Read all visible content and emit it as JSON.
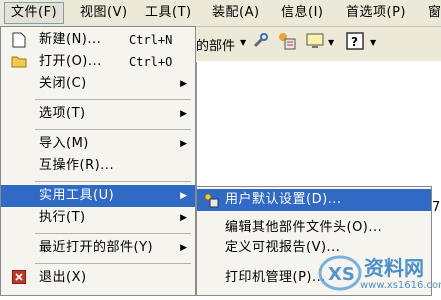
{
  "menubar": {
    "items": [
      {
        "label": "文件(F)",
        "active": true
      },
      {
        "label": "视图(V)"
      },
      {
        "label": "工具(T)"
      },
      {
        "label": "装配(A)"
      },
      {
        "label": "信息(I)"
      },
      {
        "label": "首选项(P)"
      },
      {
        "label": "窗"
      }
    ]
  },
  "toolbar": {
    "partial_text": "的部件",
    "icons": [
      "tool-icon",
      "part-navigator-icon",
      "monitor-icon",
      "help-icon"
    ]
  },
  "file_menu": {
    "items": [
      {
        "label": "新建(N)...",
        "shortcut": "Ctrl+N",
        "icon": "new-file-icon"
      },
      {
        "label": "打开(O)...",
        "shortcut": "Ctrl+O",
        "icon": "open-folder-icon"
      },
      {
        "label": "关闭(C)",
        "submenu": true
      },
      {
        "label": "选项(T)",
        "submenu": true
      },
      {
        "label": "导入(M)",
        "submenu": true
      },
      {
        "label": "互操作(R)..."
      },
      {
        "label": "实用工具(U)",
        "submenu": true,
        "highlighted": true
      },
      {
        "label": "执行(T)",
        "submenu": true
      },
      {
        "label": "最近打开的部件(Y)",
        "submenu": true
      },
      {
        "label": "退出(X)",
        "icon": "exit-icon"
      }
    ]
  },
  "utilities_submenu": {
    "items": [
      {
        "label": "用户默认设置(D)...",
        "highlighted": true,
        "icon": "user-defaults-icon"
      },
      {
        "label": "编辑其他部件文件头(O)..."
      },
      {
        "label": "定义可视报告(V)..."
      },
      {
        "label": "打印机管理(P)..."
      }
    ]
  },
  "edge_fragment": "7",
  "watermark": {
    "text": "资料网",
    "url": "www.xs1616.com"
  },
  "colors": {
    "highlight": "#316ac5",
    "menubar_bg": "#ece9d8",
    "menu_bg": "#f5f4ef"
  }
}
